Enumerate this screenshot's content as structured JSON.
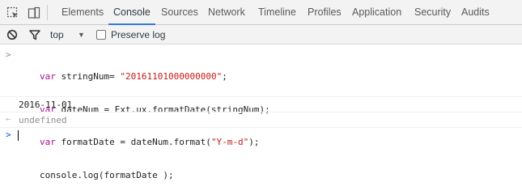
{
  "tabs": [
    {
      "label": "Elements"
    },
    {
      "label": "Console"
    },
    {
      "label": "Sources"
    },
    {
      "label": "Network"
    },
    {
      "label": "Timeline"
    },
    {
      "label": "Profiles"
    },
    {
      "label": "Application"
    },
    {
      "label": "Security"
    },
    {
      "label": "Audits"
    }
  ],
  "active_tab": "Console",
  "toolbar": {
    "context": "top",
    "preserve_log_label": "Preserve log",
    "preserve_log_checked": false
  },
  "console": {
    "input_prompt": ">",
    "input_lines": [
      {
        "kw": "var",
        "rest": " stringNum= ",
        "str": "\"20161101000000000\"",
        "tail": ";"
      },
      {
        "kw": "var",
        "rest": " dateNum = Ext.ux.formatDate(stringNum);",
        "str": "",
        "tail": ""
      },
      {
        "kw": "var",
        "rest": " formatDate = dateNum.format(",
        "str": "\"Y-m-d\"",
        "tail": ");"
      },
      {
        "kw": "",
        "rest": "console.log(formatDate );",
        "str": "",
        "tail": ""
      }
    ],
    "log_output": "2016-11-01",
    "result_prompt": "←",
    "result_value": "undefined",
    "active_prompt": ">"
  },
  "colors": {
    "accent": "#3879d9",
    "keyword": "#aa0d91",
    "string": "#c41a16",
    "prompt_blue": "#3879d9",
    "muted": "#8e8e8e"
  },
  "icons": [
    "inspect-element-icon",
    "device-mode-icon",
    "clear-console-icon",
    "filter-icon",
    "dropdown-caret-icon"
  ]
}
